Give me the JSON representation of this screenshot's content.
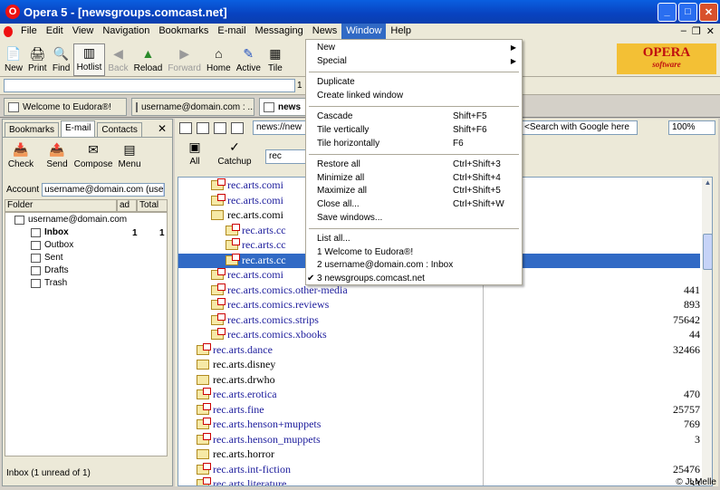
{
  "window": {
    "title": "Opera 5 - [newsgroups.comcast.net]",
    "icon_letter": "O"
  },
  "menubar": {
    "items": [
      "File",
      "Edit",
      "View",
      "Navigation",
      "Bookmarks",
      "E-mail",
      "Messaging",
      "News",
      "Window",
      "Help"
    ],
    "active": "Window"
  },
  "toolbar": {
    "buttons": [
      {
        "label": "New",
        "icon": "new-page-icon"
      },
      {
        "label": "Print",
        "icon": "printer-icon"
      },
      {
        "label": "Find",
        "icon": "binoculars-icon"
      },
      {
        "label": "Hotlist",
        "icon": "hotlist-icon"
      },
      {
        "label": "Back",
        "icon": "back-arrow-icon",
        "disabled": true
      },
      {
        "label": "Reload",
        "icon": "reload-icon"
      },
      {
        "label": "Forward",
        "icon": "forward-arrow-icon",
        "disabled": true
      },
      {
        "label": "Home",
        "icon": "home-icon"
      },
      {
        "label": "Active",
        "icon": "active-icon"
      },
      {
        "label": "Tile",
        "icon": "tile-icon"
      }
    ]
  },
  "logo": {
    "brand": "OPERA",
    "tagline": "software"
  },
  "address_row": {
    "number": "1"
  },
  "tabs": [
    {
      "label": "Welcome to Eudora®!"
    },
    {
      "label": "username@domain.com : ..."
    },
    {
      "label": "news"
    }
  ],
  "panel": {
    "tabs": [
      "Bookmarks",
      "E-mail",
      "Contacts"
    ],
    "active_tab": "E-mail",
    "close": "✕",
    "tools": [
      {
        "label": "Check",
        "icon": "check-mail-icon"
      },
      {
        "label": "Send",
        "icon": "send-mail-icon"
      },
      {
        "label": "Compose",
        "icon": "compose-icon"
      },
      {
        "label": "Menu",
        "icon": "menu-icon"
      }
    ],
    "account_label": "Account",
    "account_value": "username@domain.com (use",
    "columns": [
      "Folder",
      "ad",
      "Total"
    ],
    "root": "username@domain.com",
    "folders": [
      {
        "name": "Inbox",
        "unread": "1",
        "total": "1"
      },
      {
        "name": "Outbox"
      },
      {
        "name": "Sent"
      },
      {
        "name": "Drafts"
      },
      {
        "name": "Trash"
      }
    ],
    "status": "Inbox (1 unread of 1)"
  },
  "main": {
    "url": "news://new",
    "search_placeholder": "<Search with Google here",
    "zoom": "100%",
    "news_tools": [
      {
        "label": "All",
        "icon": "all-groups-icon"
      },
      {
        "label": "Catchup",
        "icon": "catchup-icon"
      }
    ],
    "filter": "rec"
  },
  "groups": [
    {
      "name": "rec.arts.comi",
      "count": "",
      "indent": 2,
      "env": true
    },
    {
      "name": "rec.arts.comi",
      "count": "",
      "indent": 2,
      "env": true
    },
    {
      "name": "rec.arts.comi",
      "count": "",
      "indent": 2,
      "env": false,
      "plain": true
    },
    {
      "name": "rec.arts.cc",
      "count": "",
      "indent": 3,
      "env": true
    },
    {
      "name": "rec.arts.cc",
      "count": "",
      "indent": 3,
      "env": true
    },
    {
      "name": "rec.arts.cc",
      "count": "",
      "indent": 3,
      "env": true,
      "selected": true
    },
    {
      "name": "rec.arts.comi",
      "count": "",
      "indent": 2,
      "env": true
    },
    {
      "name": "rec.arts.comics.other-media",
      "count": "441",
      "indent": 2,
      "env": true
    },
    {
      "name": "rec.arts.comics.reviews",
      "count": "893",
      "indent": 2,
      "env": true
    },
    {
      "name": "rec.arts.comics.strips",
      "count": "75642",
      "indent": 2,
      "env": true
    },
    {
      "name": "rec.arts.comics.xbooks",
      "count": "44",
      "indent": 2,
      "env": true
    },
    {
      "name": "rec.arts.dance",
      "count": "32466",
      "indent": 1,
      "env": true
    },
    {
      "name": "rec.arts.disney",
      "count": "",
      "indent": 1,
      "env": false,
      "plain": true
    },
    {
      "name": "rec.arts.drwho",
      "count": "",
      "indent": 1,
      "env": false,
      "plain": true
    },
    {
      "name": "rec.arts.erotica",
      "count": "470",
      "indent": 1,
      "env": true
    },
    {
      "name": "rec.arts.fine",
      "count": "25757",
      "indent": 1,
      "env": true
    },
    {
      "name": "rec.arts.henson+muppets",
      "count": "769",
      "indent": 1,
      "env": true
    },
    {
      "name": "rec.arts.henson_muppets",
      "count": "3",
      "indent": 1,
      "env": true
    },
    {
      "name": "rec.arts.horror",
      "count": "",
      "indent": 1,
      "env": false,
      "plain": true
    },
    {
      "name": "rec.arts.int-fiction",
      "count": "25476",
      "indent": 1,
      "env": true
    },
    {
      "name": "rec.arts.literature",
      "count": "33",
      "indent": 1,
      "env": true
    }
  ],
  "window_menu": [
    {
      "label": "New",
      "arrow": "▶"
    },
    {
      "label": "Special",
      "arrow": "▶"
    },
    {
      "sep": true
    },
    {
      "label": "Duplicate"
    },
    {
      "label": "Create linked window"
    },
    {
      "sep": true
    },
    {
      "label": "Cascade",
      "shortcut": "Shift+F5"
    },
    {
      "label": "Tile vertically",
      "shortcut": "Shift+F6"
    },
    {
      "label": "Tile horizontally",
      "shortcut": "F6"
    },
    {
      "sep": true
    },
    {
      "label": "Restore all",
      "shortcut": "Ctrl+Shift+3"
    },
    {
      "label": "Minimize all",
      "shortcut": "Ctrl+Shift+4"
    },
    {
      "label": "Maximize all",
      "shortcut": "Ctrl+Shift+5"
    },
    {
      "label": "Close all...",
      "shortcut": "Ctrl+Shift+W"
    },
    {
      "label": "Save windows..."
    },
    {
      "sep": true
    },
    {
      "label": "List all..."
    },
    {
      "label": "1  Welcome to Eudora®!"
    },
    {
      "label": "2  username@domain.com : Inbox"
    },
    {
      "label": "3  newsgroups.comcast.net",
      "checked": "✔"
    }
  ],
  "copyright": "© JLMelle",
  "colors": {
    "title_blue": "#0842c0",
    "selection": "#316ac5",
    "link": "#1c1c9c",
    "logo_bg": "#f3c035"
  }
}
